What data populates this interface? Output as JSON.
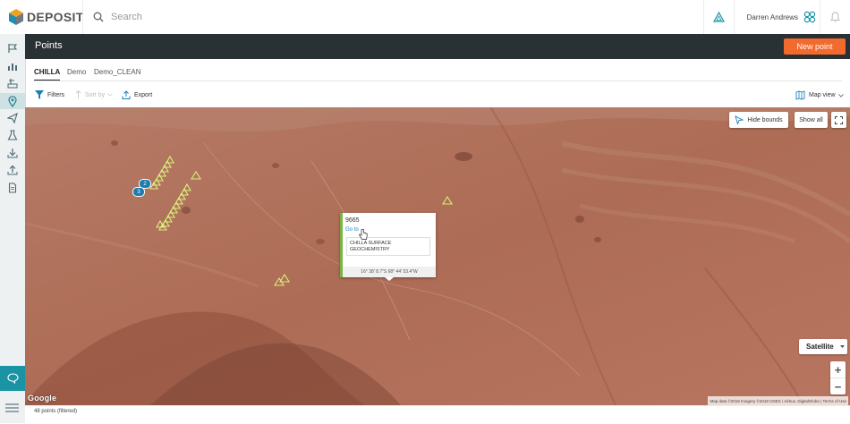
{
  "app": {
    "name": "DEPOSIT"
  },
  "search": {
    "placeholder": "Search"
  },
  "user": {
    "name": "Darren Andrews"
  },
  "header": {
    "title": "Points",
    "new_button": "New point"
  },
  "tabs": [
    {
      "label": "CHILLA"
    },
    {
      "label": "Demo"
    },
    {
      "label": "Demo_CLEAN"
    }
  ],
  "toolbar": {
    "filters": "Filters",
    "sort": "Sort by",
    "export": "Export",
    "map_view": "Map view"
  },
  "map": {
    "hide_bounds": "Hide bounds",
    "show_all": "Show all",
    "map_type": "Satellite",
    "zoom_in": "+",
    "zoom_out": "−",
    "google": "Google",
    "attribution": "Map data ©2018 Imagery ©2018 CNES / Airbus, DigitalGlobe | Terms of Use",
    "clusters": [
      "2",
      "3"
    ]
  },
  "popup": {
    "id": "9665",
    "goto": "Go to",
    "project": "CHILLA SURFACE GEOCHEMISTRY",
    "coords": "16° 38' 8.7\"S   68° 44' 53.4\"W"
  },
  "status": {
    "text": "48 points (filtered)"
  },
  "colors": {
    "accent": "#f26a2d",
    "header": "#2a3135",
    "teal": "#1a93a4",
    "marker": "#d9f07a",
    "popup_bar": "#7cb342"
  }
}
